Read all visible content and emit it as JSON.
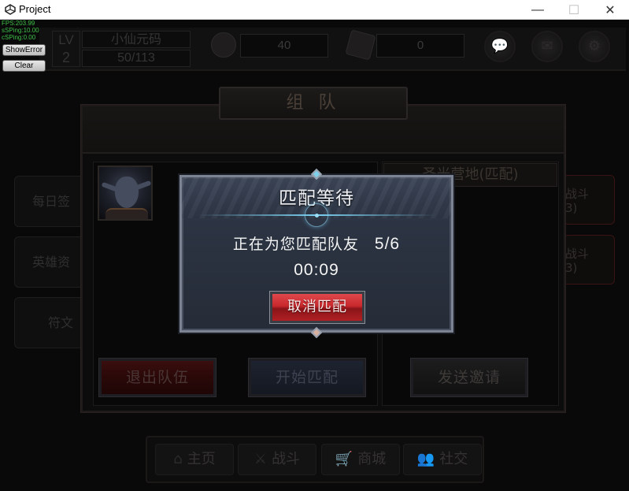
{
  "window": {
    "title": "Project",
    "controls": {
      "minimize": "—",
      "maximize": "☐",
      "close": "✕"
    }
  },
  "debug": {
    "fps": "FPS:203.99",
    "s_ping": "sSPing:10.00",
    "c_ping": "cSPing:0.00",
    "show_error_label": "ShowError",
    "clear_label": "Clear"
  },
  "player": {
    "lv_label": "LV",
    "level": "2",
    "name": "小仙元码",
    "exp": "50/113"
  },
  "resources": {
    "coins": "40",
    "gems": "0"
  },
  "top_icons": {
    "chat": "💬",
    "mail": "✉",
    "settings": "⚙"
  },
  "side_menu": [
    "每日签",
    "英雄资",
    "符文"
  ],
  "right_menu": [
    {
      "line1": "战斗",
      "line2": "3)"
    },
    {
      "line1": "战斗",
      "line2": "3)"
    }
  ],
  "team_panel": {
    "title": "组 队",
    "map_title": "圣光营地(匹配)",
    "buttons": {
      "leave_team": "退出队伍",
      "start_match": "开始匹配",
      "send_invite": "发送邀请"
    }
  },
  "match_modal": {
    "title": "匹配等待",
    "status": "正在为您匹配队友",
    "count": "5/6",
    "timer": "00:09",
    "cancel_label": "取消匹配"
  },
  "bottom_nav": [
    {
      "label": "主页",
      "icon": "⌂"
    },
    {
      "label": "战斗",
      "icon": "⚔"
    },
    {
      "label": "商城",
      "icon": "🛒"
    },
    {
      "label": "社交",
      "icon": "👥"
    }
  ]
}
